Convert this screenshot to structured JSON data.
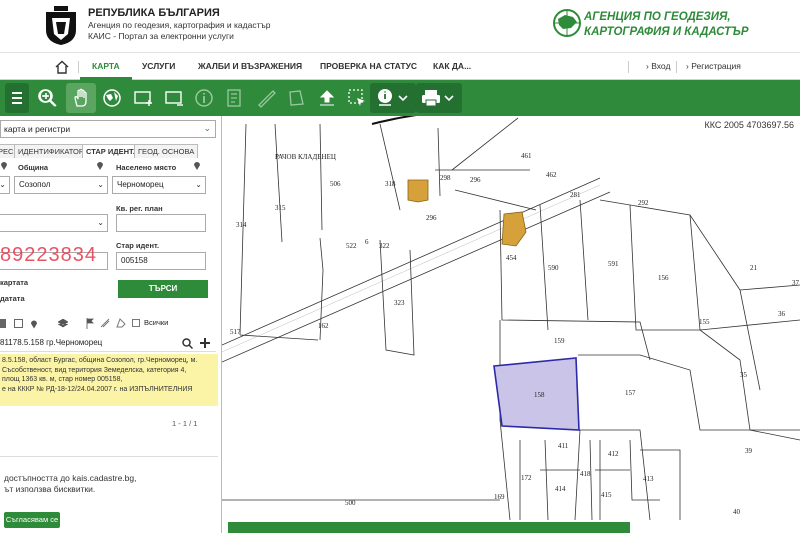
{
  "header": {
    "title": "РЕПУБЛИКА БЪЛГАРИЯ",
    "subtitle1": "Агенция по геодезия, картография и кадастър",
    "subtitle2": "КАИС - Портал за електронни услуги",
    "agency_line1": "АГЕНЦИЯ ПО ГЕОДЕЗИЯ,",
    "agency_line2": "КАРТОГРАФИЯ И КАДАСТЪР"
  },
  "nav": {
    "home_icon": "home-icon",
    "map": "КАРТА",
    "services": "УСЛУГИ",
    "complaints": "ЖАЛБИ И ВЪЗРАЖЕНИЯ",
    "status": "ПРОВЕРКА НА СТАТУС",
    "more": "КАК ДА...",
    "login": "› Вход",
    "register": "› Регистрация"
  },
  "toolbar": {
    "buttons": [
      "zoom-in-icon",
      "zoom-out-icon",
      "pan-hand-icon",
      "globe-icon",
      "zoom-box-icon",
      "full-extent-icon",
      "info-icon",
      "layers-icon",
      "measure-length-icon",
      "measure-area-icon",
      "upload-icon",
      "select-icon",
      "identify-icon",
      "print-icon"
    ],
    "accent": "#2f8a3c"
  },
  "panel": {
    "layers_select": "карта и регистри",
    "tabs": [
      "РЕС",
      "ИДЕНТИФИКАТОР",
      "СТАР ИДЕНТ.",
      "ГЕОД. ОСНОВА"
    ],
    "labels": {
      "municipality": "Община",
      "settlement": "Населено място",
      "reg_plan": "Кв. рег. план",
      "old_ident": "Стар идент.",
      "map_row": "картата",
      "data_row": "датата"
    },
    "values": {
      "municipality": "Созопол",
      "settlement": "Черноморец",
      "old_ident": "005158"
    },
    "overlay_number": "89223834",
    "search_button": "ТЪРСИ",
    "filter_all": "Всички",
    "result_header": "81178.5.158 гр.Черноморец",
    "result_lines": [
      "8.5.158, област Бургас, община Созопол, гр.Черноморец, м.",
      "Съсобственост, вид територия Земеделска, категория 4,",
      "площ 1363 кв. м, стар номер 005158,",
      "е на КККР № РД-18-12/24.04.2007 г. на ИЗПЪЛНИТЕЛНИЯ"
    ],
    "pager": "1 - 1 / 1",
    "cookie_text_1": "достъпността до kais.cadastre.bg,",
    "cookie_text_2": "ът използва бисквитки.",
    "cookie_button": "Съгласявам се"
  },
  "map": {
    "coords": "ККС 2005 4703697.56",
    "area_label": "РАЧОВ КЛАДЕНЕЦ",
    "parcels": [
      "461",
      "506",
      "318",
      "298",
      "296",
      "462",
      "281",
      "292",
      "315",
      "314",
      "296",
      "6",
      "322",
      "522",
      "454",
      "590",
      "591",
      "156",
      "21",
      "37",
      "323",
      "162",
      "517",
      "155",
      "36",
      "159",
      "158",
      "157",
      "35",
      "411",
      "412",
      "39",
      "172",
      "414",
      "418",
      "413",
      "169",
      "415",
      "500",
      "40"
    ],
    "selected_parcel": "158",
    "highlight_color": "#c9c4e8"
  }
}
